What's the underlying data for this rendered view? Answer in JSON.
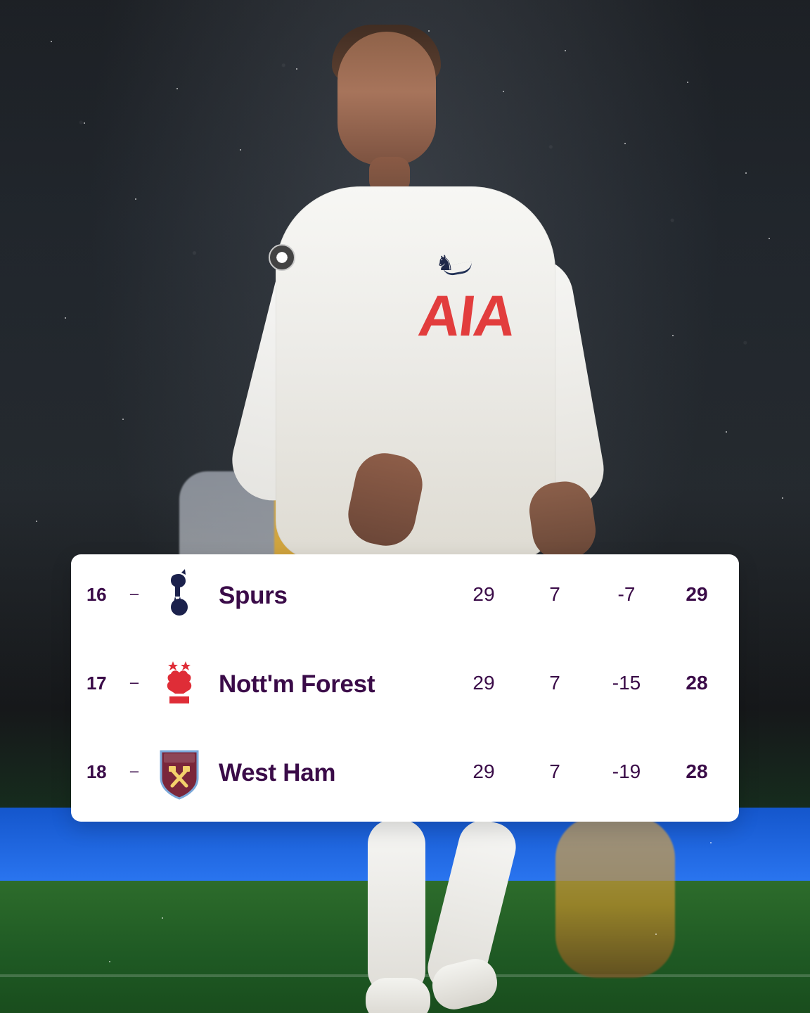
{
  "table": {
    "rows": [
      {
        "position": "16",
        "movement": "–",
        "club": "Spurs",
        "played": "29",
        "won": "7",
        "goal_difference": "-7",
        "points": "29",
        "badge": "spurs-badge"
      },
      {
        "position": "17",
        "movement": "–",
        "club": "Nott'm Forest",
        "played": "29",
        "won": "7",
        "goal_difference": "-15",
        "points": "28",
        "badge": "nottingham-forest-badge"
      },
      {
        "position": "18",
        "movement": "–",
        "club": "West Ham",
        "played": "29",
        "won": "7",
        "goal_difference": "-19",
        "points": "28",
        "badge": "west-ham-badge"
      }
    ]
  },
  "graphics": {
    "sponsor_text": "AIA",
    "spurs_badge_color": "#1b214c",
    "forest_badge_color": "#df2d37",
    "west_ham_badge_color": "#7a263a",
    "card_text_color": "#3a0b48"
  }
}
